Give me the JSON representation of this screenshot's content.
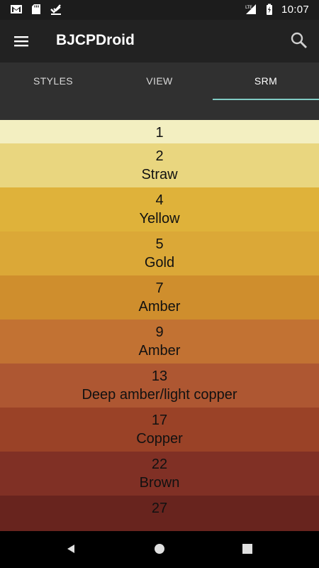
{
  "status_bar": {
    "time": "10:07",
    "icons": [
      "gmail-icon",
      "sd-card-icon",
      "download-check-icon",
      "lte-signal-icon",
      "battery-charging-icon"
    ]
  },
  "app_bar": {
    "title": "BJCPDroid",
    "menu_icon": "hamburger-menu-icon",
    "search_icon": "search-icon"
  },
  "tabs": [
    {
      "label": "STYLES",
      "active": false
    },
    {
      "label": "VIEW",
      "active": false
    },
    {
      "label": "SRM",
      "active": true
    }
  ],
  "srm_list": [
    {
      "srm": "1",
      "name": "",
      "color": "#f3efc1"
    },
    {
      "srm": "2",
      "name": "Straw",
      "color": "#e9d67f"
    },
    {
      "srm": "4",
      "name": "Yellow",
      "color": "#dfb23a"
    },
    {
      "srm": "5",
      "name": "Gold",
      "color": "#dba837"
    },
    {
      "srm": "7",
      "name": "Amber",
      "color": "#cf8e2d"
    },
    {
      "srm": "9",
      "name": "Amber",
      "color": "#c27233"
    },
    {
      "srm": "13",
      "name": "Deep amber/light copper",
      "color": "#ae5732"
    },
    {
      "srm": "17",
      "name": "Copper",
      "color": "#9a4227"
    },
    {
      "srm": "22",
      "name": "Brown",
      "color": "#803025"
    },
    {
      "srm": "27",
      "name": "",
      "color": "#68241e"
    }
  ],
  "nav_bar": {
    "back_icon": "back-triangle-icon",
    "home_icon": "home-circle-icon",
    "recents_icon": "recents-square-icon"
  }
}
